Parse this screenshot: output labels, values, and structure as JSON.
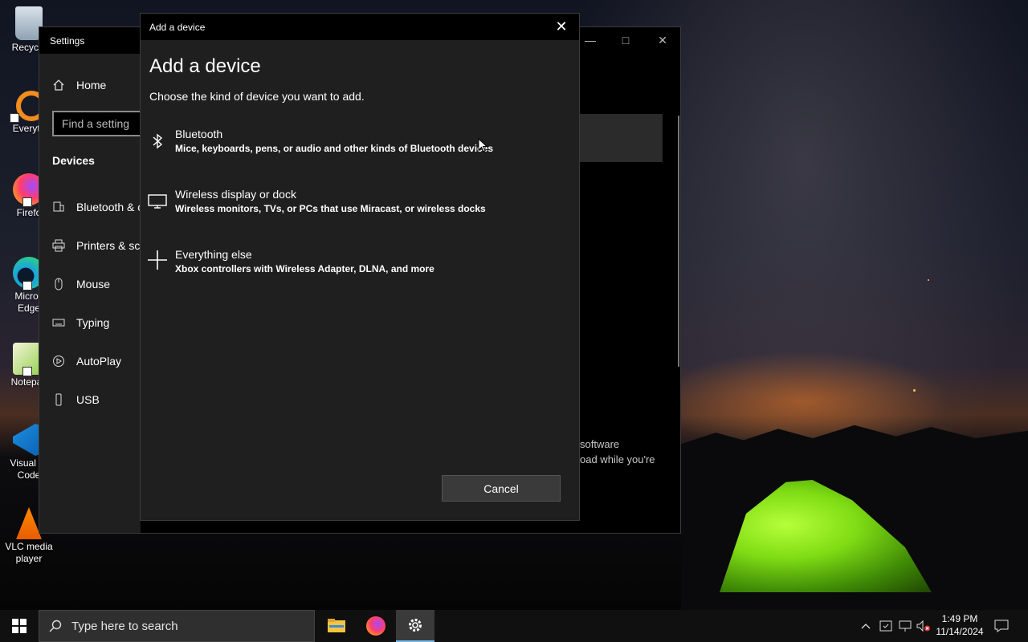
{
  "desktop": {
    "icons": [
      {
        "label": "Recycle",
        "icon": "recycle-bin-icon"
      },
      {
        "label": "Everyth",
        "icon": "everything-search-icon"
      },
      {
        "label": "Firefo",
        "icon": "firefox-icon"
      },
      {
        "label": "Micros Edge",
        "icon": "edge-icon"
      },
      {
        "label": "Notepac",
        "icon": "notepad-plus-plus-icon"
      },
      {
        "label": "Visual St Code",
        "icon": "vscode-icon"
      },
      {
        "label": "VLC media player",
        "icon": "vlc-icon"
      }
    ]
  },
  "settings": {
    "title": "Settings",
    "home_label": "Home",
    "search_placeholder": "Find a setting",
    "section_heading": "Devices",
    "nav": [
      {
        "label": "Bluetooth & o",
        "icon": "bluetooth-devices-icon"
      },
      {
        "label": "Printers & sca",
        "icon": "printer-icon"
      },
      {
        "label": "Mouse",
        "icon": "mouse-icon"
      },
      {
        "label": "Typing",
        "icon": "keyboard-icon"
      },
      {
        "label": "AutoPlay",
        "icon": "autoplay-icon"
      },
      {
        "label": "USB",
        "icon": "usb-icon"
      }
    ],
    "background_text_line1": "software",
    "background_text_line2": "oad while you're"
  },
  "dialog": {
    "window_title": "Add a device",
    "heading": "Add a device",
    "subtitle": "Choose the kind of device you want to add.",
    "options": [
      {
        "title": "Bluetooth",
        "description": "Mice, keyboards, pens, or audio and other kinds of Bluetooth devices",
        "icon": "bluetooth-icon"
      },
      {
        "title": "Wireless display or dock",
        "description": "Wireless monitors, TVs, or PCs that use Miracast, or wireless docks",
        "icon": "monitor-icon"
      },
      {
        "title": "Everything else",
        "description": "Xbox controllers with Wireless Adapter, DLNA, and more",
        "icon": "plus-icon"
      }
    ],
    "cancel_label": "Cancel"
  },
  "taskbar": {
    "search_placeholder": "Type here to search",
    "apps": [
      "file-explorer-icon",
      "firefox-icon",
      "settings-gear-icon"
    ],
    "time": "1:49 PM",
    "date": "11/14/2024"
  },
  "colors": {
    "accent": "#76b9ed",
    "dialog_bg": "#1f1f1f",
    "titlebar_bg": "#000000",
    "tent_green": "#7fdc14"
  }
}
